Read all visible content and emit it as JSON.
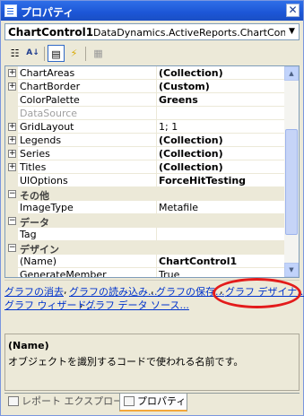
{
  "window": {
    "title": "プロパティ",
    "close_glyph": "✕"
  },
  "object_selector": {
    "name": "ChartControl1",
    "type": "DataDynamics.ActiveReports.ChartControl",
    "dropdown_glyph": "▼"
  },
  "toolbar": {
    "buttons": [
      {
        "name": "categorized",
        "icon": "categorized-icon",
        "glyph": "☷"
      },
      {
        "name": "alphabetical",
        "icon": "alphabetical-icon",
        "glyph": "A↓"
      },
      {
        "name": "properties",
        "icon": "properties-icon",
        "glyph": "▤"
      },
      {
        "name": "events",
        "icon": "events-lightning-icon",
        "glyph": "⚡"
      },
      {
        "name": "property-pages",
        "icon": "property-pages-icon",
        "glyph": "▦"
      }
    ]
  },
  "grid": {
    "rows": [
      {
        "name": "ChartAreas",
        "value": "(Collection)",
        "bold": true,
        "expand": "+"
      },
      {
        "name": "ChartBorder",
        "value": "(Custom)",
        "bold": true,
        "expand": "+"
      },
      {
        "name": "ColorPalette",
        "value": "Greens",
        "bold": true
      },
      {
        "name": "DataSource",
        "value": "",
        "disabled": true
      },
      {
        "name": "GridLayout",
        "value": "1; 1",
        "expand": "+"
      },
      {
        "name": "Legends",
        "value": "(Collection)",
        "bold": true,
        "expand": "+"
      },
      {
        "name": "Series",
        "value": "(Collection)",
        "bold": true,
        "expand": "+"
      },
      {
        "name": "Titles",
        "value": "(Collection)",
        "bold": true,
        "expand": "+"
      },
      {
        "name": "UIOptions",
        "value": "ForceHitTesting",
        "bold": true
      },
      {
        "category": "その他",
        "expand": "−"
      },
      {
        "name": "ImageType",
        "value": "Metafile"
      },
      {
        "category": "データ",
        "expand": "−"
      },
      {
        "name": "Tag",
        "value": ""
      },
      {
        "category": "デザイン",
        "expand": "−"
      },
      {
        "name": "(Name)",
        "value": "ChartControl1",
        "bold": true
      },
      {
        "name": "GenerateMember",
        "value": "True"
      }
    ],
    "scroll_up_glyph": "▲",
    "scroll_down_glyph": "▼"
  },
  "verbs": {
    "clear": "グラフの消去",
    "load": "グラフの読み込み...",
    "save": "グラフの保存...",
    "designer": "グラフ デザイナ...",
    "wizard": "グラフ ウィザード...",
    "datasource": "グラフ データ ソース...",
    "separator": ","
  },
  "description": {
    "title": "(Name)",
    "text": "オブジェクトを識別するコードで使われる名前です。"
  },
  "tabs": [
    {
      "label": "レポート エクスプローラ",
      "icon": "report-explorer-icon",
      "active": false
    },
    {
      "label": "プロパティ",
      "icon": "properties-icon",
      "active": true
    }
  ],
  "colors": {
    "title_bar": "#1c56d6",
    "link": "#0033cc",
    "highlight_ellipse": "#e31b1b"
  }
}
